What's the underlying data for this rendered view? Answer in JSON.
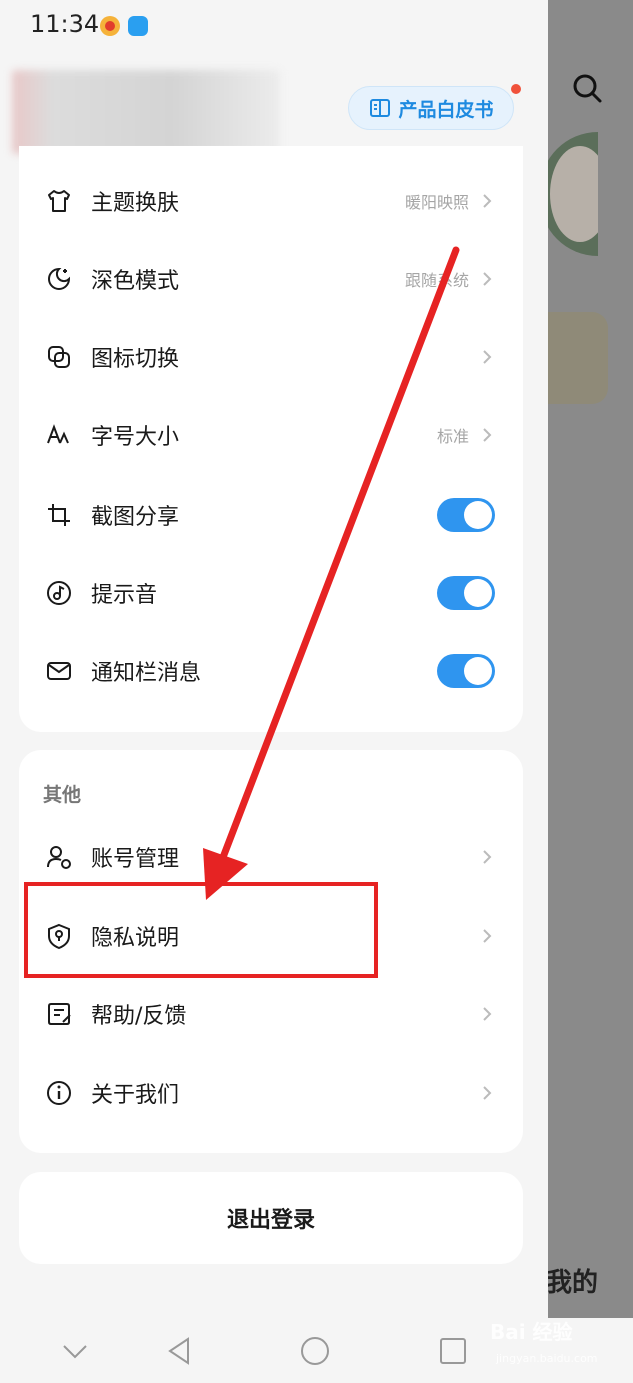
{
  "status_bar": {
    "time": "11:34"
  },
  "header": {
    "whitepaper_label": "产品白皮书"
  },
  "settings": [
    {
      "label": "主题换肤",
      "value": "暖阳映照",
      "control": "chevron",
      "icon": "tshirt-icon"
    },
    {
      "label": "深色模式",
      "value": "跟随系统",
      "control": "chevron",
      "icon": "moon-icon"
    },
    {
      "label": "图标切换",
      "value": "",
      "control": "chevron",
      "icon": "icon-switch-icon"
    },
    {
      "label": "字号大小",
      "value": "标准",
      "control": "chevron",
      "icon": "font-size-icon"
    },
    {
      "label": "截图分享",
      "value": "",
      "control": "toggle",
      "on": true,
      "icon": "crop-icon"
    },
    {
      "label": "提示音",
      "value": "",
      "control": "toggle",
      "on": true,
      "icon": "music-note-icon"
    },
    {
      "label": "通知栏消息",
      "value": "",
      "control": "toggle",
      "on": true,
      "icon": "mail-icon"
    }
  ],
  "other": {
    "title": "其他",
    "items": [
      {
        "label": "账号管理",
        "icon": "account-settings-icon"
      },
      {
        "label": "隐私说明",
        "icon": "privacy-shield-icon"
      },
      {
        "label": "帮助/反馈",
        "icon": "feedback-icon"
      },
      {
        "label": "关于我们",
        "icon": "info-icon"
      }
    ]
  },
  "logout_label": "退出登录",
  "background": {
    "tab_mine": "我的"
  },
  "watermark": {
    "text": "Bai 经验",
    "sub": "jingyan.baidu.com"
  },
  "colors": {
    "accent": "#2f95ef",
    "annotation": "#e62323",
    "badge": "#f0513a"
  }
}
